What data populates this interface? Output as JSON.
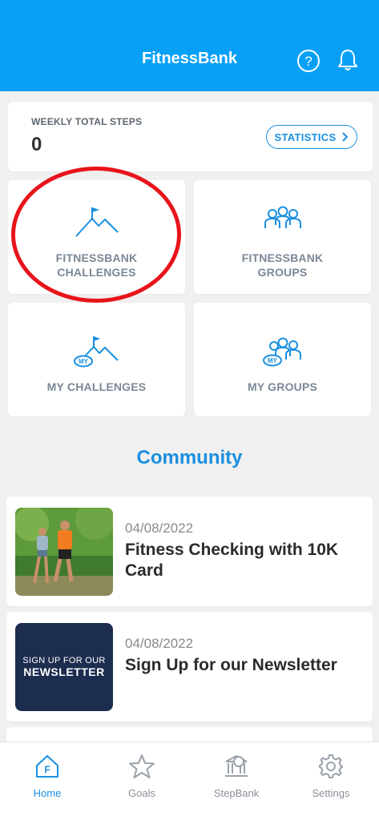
{
  "header": {
    "title": "FitnessBank"
  },
  "steps": {
    "label": "WEEKLY TOTAL STEPS",
    "value": "0",
    "statistics_label": "STATISTICS"
  },
  "tiles": [
    {
      "line1": "FITNESSBANK",
      "line2": "CHALLENGES"
    },
    {
      "line1": "FITNESSBANK",
      "line2": "GROUPS"
    },
    {
      "line1": "MY CHALLENGES",
      "line2": ""
    },
    {
      "line1": "MY GROUPS",
      "line2": ""
    }
  ],
  "icon_badge": "MY",
  "community": {
    "title": "Community"
  },
  "news": [
    {
      "date": "04/08/2022",
      "title": "Fitness Checking with 10K Card"
    },
    {
      "date": "04/08/2022",
      "title": "Sign Up for our Newsletter",
      "thumb_line1": "SIGN UP FOR OUR",
      "thumb_line2": "NEWSLETTER"
    }
  ],
  "nav": [
    {
      "label": "Home",
      "icon": "home-icon",
      "active": true
    },
    {
      "label": "Goals",
      "icon": "star-icon",
      "active": false
    },
    {
      "label": "StepBank",
      "icon": "stepbank-icon",
      "active": false
    },
    {
      "label": "Settings",
      "icon": "gear-icon",
      "active": false
    }
  ],
  "colors": {
    "header": "#08a0f7",
    "accent": "#1a8fe0",
    "highlight": "#e8141b",
    "newsletter": "#1d2d50"
  }
}
